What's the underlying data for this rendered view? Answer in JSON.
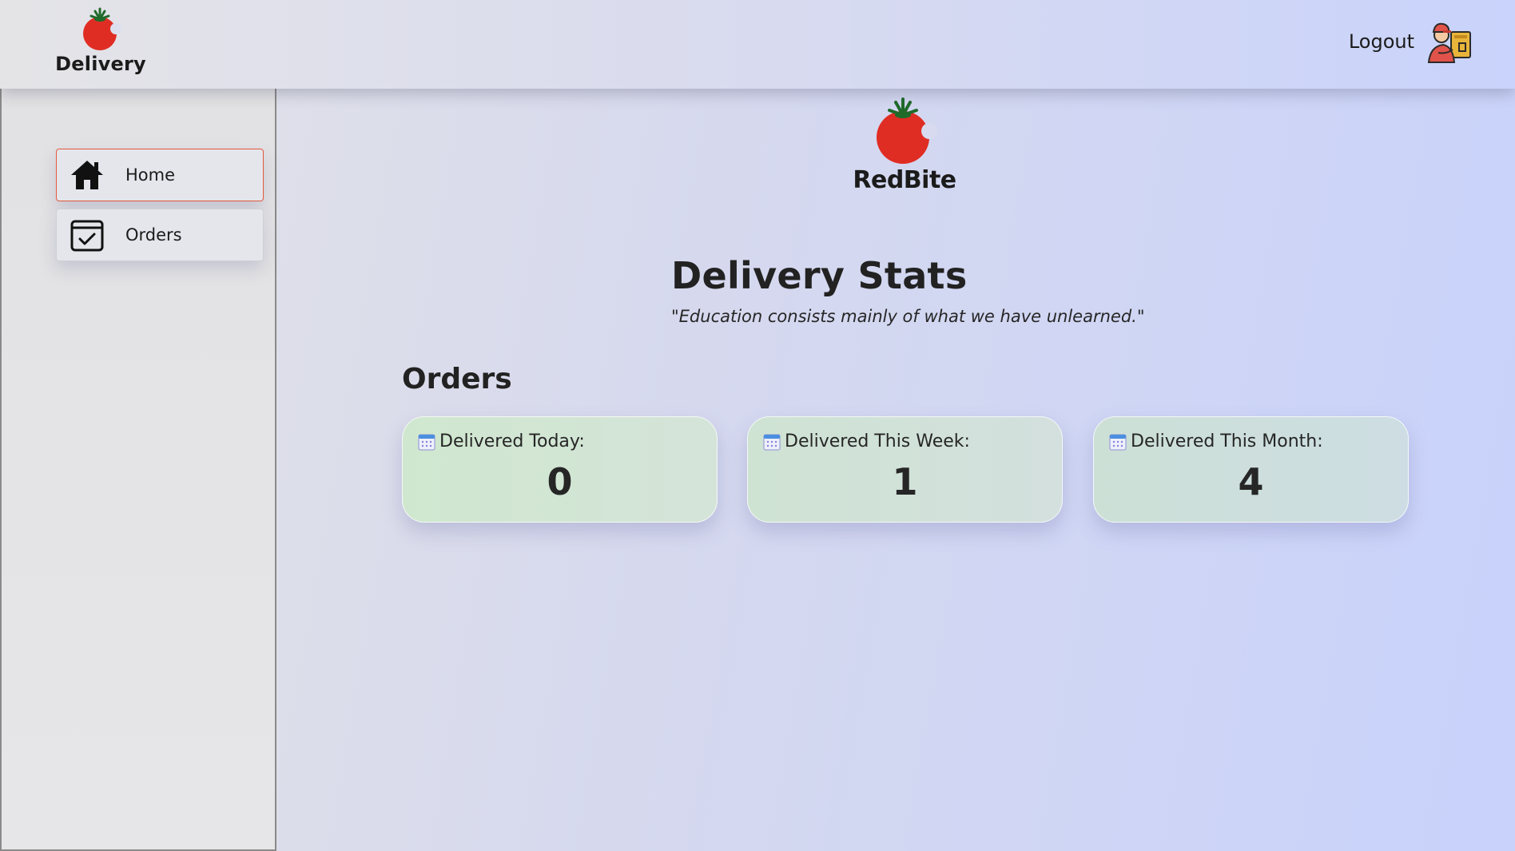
{
  "header": {
    "brand_label": "Delivery",
    "logout_label": "Logout"
  },
  "sidebar": {
    "items": [
      {
        "label": "Home",
        "icon": "home-icon",
        "active": true
      },
      {
        "label": "Orders",
        "icon": "calendar-check-icon",
        "active": false
      }
    ]
  },
  "main": {
    "logo_text": "RedBite",
    "title": "Delivery Stats",
    "quote": "\"Education consists mainly of what we have unlearned.\"",
    "section_title": "Orders",
    "cards": [
      {
        "label": "Delivered Today:",
        "value": "0",
        "icon": "calendar-icon"
      },
      {
        "label": "Delivered This Week:",
        "value": "1",
        "icon": "calendar-icon"
      },
      {
        "label": "Delivered This Month:",
        "value": "4",
        "icon": "calendar-icon"
      }
    ]
  },
  "colors": {
    "accent": "#e2583a",
    "tomato": "#e02d24",
    "leaf": "#1f6b2a"
  }
}
